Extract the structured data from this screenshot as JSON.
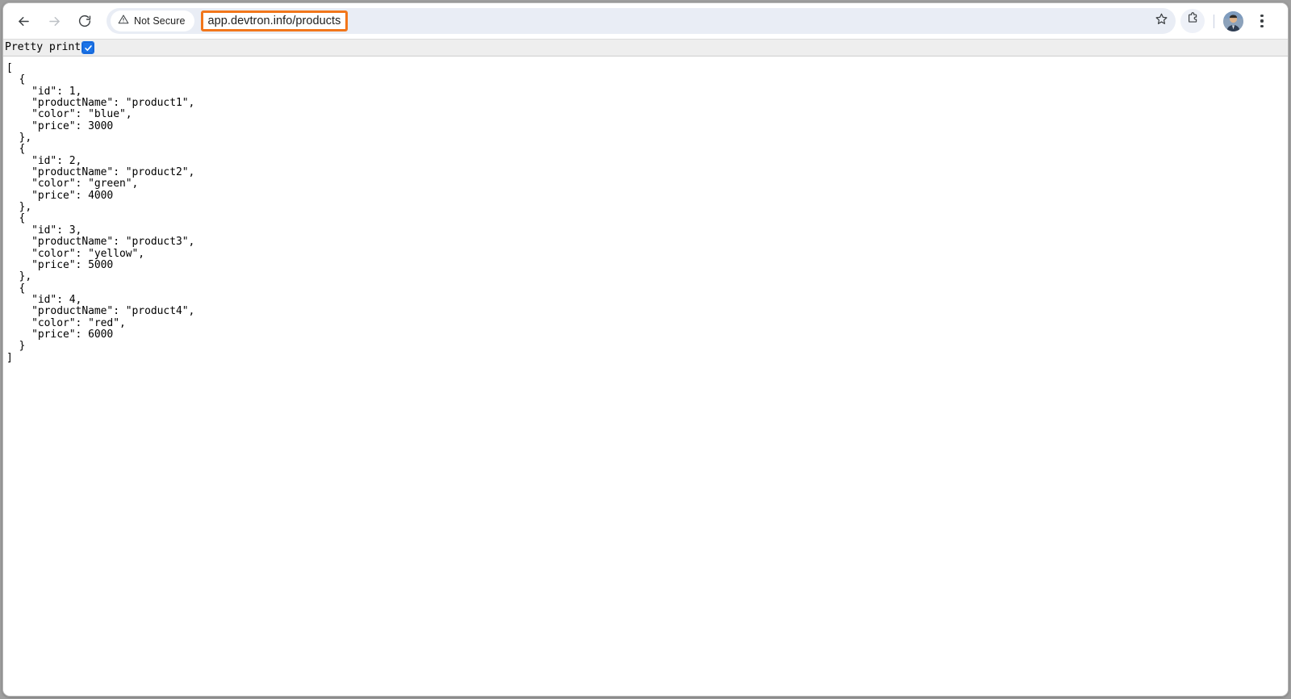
{
  "browser": {
    "nav": {
      "back_icon": "arrow-left-icon",
      "forward_icon": "arrow-right-icon",
      "reload_icon": "reload-icon"
    },
    "omnibox": {
      "security_label": "Not Secure",
      "security_icon": "warning-triangle-icon",
      "url": "app.devtron.info/products",
      "star_icon": "bookmark-star-icon",
      "annotation_color": "#f2761b"
    },
    "toolbar_right": {
      "extensions_icon": "puzzle-piece-icon",
      "avatar_icon": "user-avatar",
      "menu_icon": "three-dot-menu-icon"
    }
  },
  "page": {
    "prettyprint": {
      "label": "Pretty print",
      "checked": true,
      "checkbox_color": "#1a73e8"
    },
    "json_text": "[\n  {\n    \"id\": 1,\n    \"productName\": \"product1\",\n    \"color\": \"blue\",\n    \"price\": 3000\n  },\n  {\n    \"id\": 2,\n    \"productName\": \"product2\",\n    \"color\": \"green\",\n    \"price\": 4000\n  },\n  {\n    \"id\": 3,\n    \"productName\": \"product3\",\n    \"color\": \"yellow\",\n    \"price\": 5000\n  },\n  {\n    \"id\": 4,\n    \"productName\": \"product4\",\n    \"color\": \"red\",\n    \"price\": 6000\n  }\n]",
    "products": [
      {
        "id": 1,
        "productName": "product1",
        "color": "blue",
        "price": 3000
      },
      {
        "id": 2,
        "productName": "product2",
        "color": "green",
        "price": 4000
      },
      {
        "id": 3,
        "productName": "product3",
        "color": "yellow",
        "price": 5000
      },
      {
        "id": 4,
        "productName": "product4",
        "color": "red",
        "price": 6000
      }
    ]
  }
}
